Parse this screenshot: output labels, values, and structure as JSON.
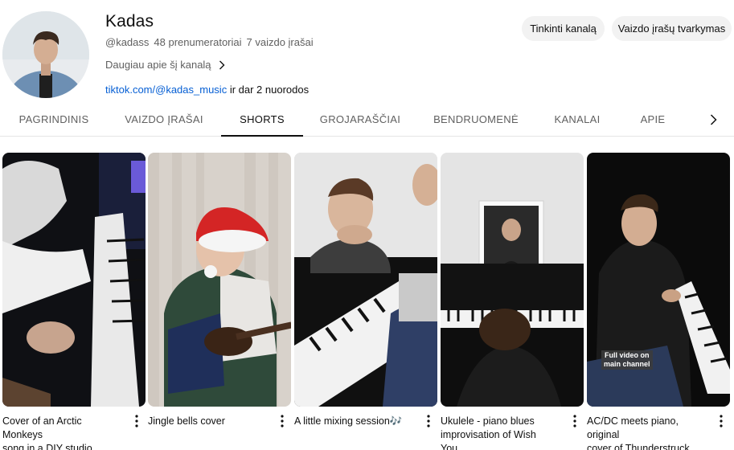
{
  "channel": {
    "name": "Kadas",
    "handle": "@kadass",
    "subscribers": "48 prenumeratoriai",
    "videos": "7 vaizdo įrašai",
    "about": "Daugiau apie šį kanalą",
    "link": "tiktok.com/@kadas_music",
    "more_links": " ir dar 2 nuorodos"
  },
  "buttons": {
    "customize": "Tinkinti kanalą",
    "manage": "Vaizdo įrašų tvarkymas"
  },
  "tabs": [
    {
      "label": "PAGRINDINIS",
      "active": false
    },
    {
      "label": "VAIZDO ĮRAŠAI",
      "active": false
    },
    {
      "label": "SHORTS",
      "active": true
    },
    {
      "label": "GROJARAŠČIAI",
      "active": false
    },
    {
      "label": "BENDRUOMENĖ",
      "active": false
    },
    {
      "label": "KANALAI",
      "active": false
    },
    {
      "label": "APIE",
      "active": false
    }
  ],
  "shorts": [
    {
      "title_line1": "Cover of an Arctic Monkeys",
      "title_line2": "song in a DIY studio"
    },
    {
      "title_line1": "Jingle bells cover",
      "title_line2": ""
    },
    {
      "title_line1": "A little mixing session🎶",
      "title_line2": ""
    },
    {
      "title_line1": "Ukulele - piano blues",
      "title_line2": "improvisation of Wish You..."
    },
    {
      "title_line1": "AC/DC meets piano, original",
      "title_line2": "cover of Thunderstruck",
      "overlay_line1": "Full video on",
      "overlay_line2": "main channel"
    }
  ],
  "icons": {
    "about_chevron": "chevron-right-icon",
    "tabs_next": "chevron-right-icon",
    "menu": "more-vert-icon"
  },
  "colors": {
    "link": "#065fd4",
    "button_bg": "#f2f2f2",
    "muted_text": "#606060"
  }
}
